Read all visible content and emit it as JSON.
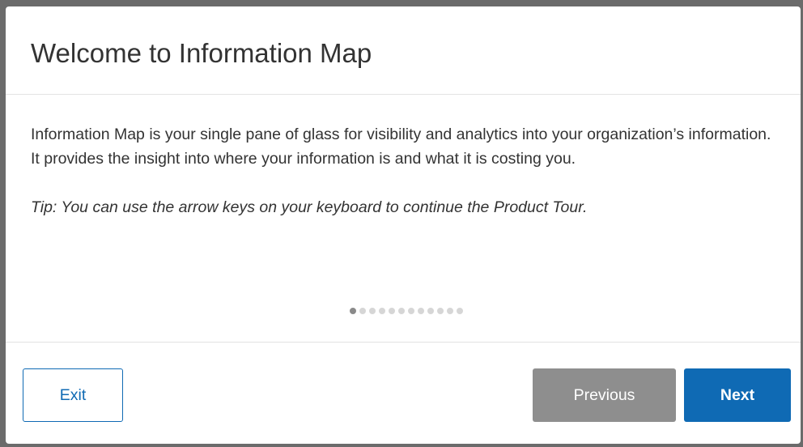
{
  "dialog": {
    "title": "Welcome to Information Map",
    "body_text": "Information Map is your single pane of glass for visibility and analytics into your organization’s information. It provides the insight into where your information is and what it is costing you.",
    "tip_text": "Tip: You can use the arrow keys on your keyboard to continue the Product Tour."
  },
  "pager": {
    "total_steps": 12,
    "current_step": 1
  },
  "footer": {
    "exit_label": "Exit",
    "previous_label": "Previous",
    "next_label": "Next"
  },
  "colors": {
    "accent": "#0f6ab4",
    "disabled_button": "#8e8e8e",
    "active_dot": "#8a8a8a",
    "inactive_dot": "#d6d6d6"
  }
}
